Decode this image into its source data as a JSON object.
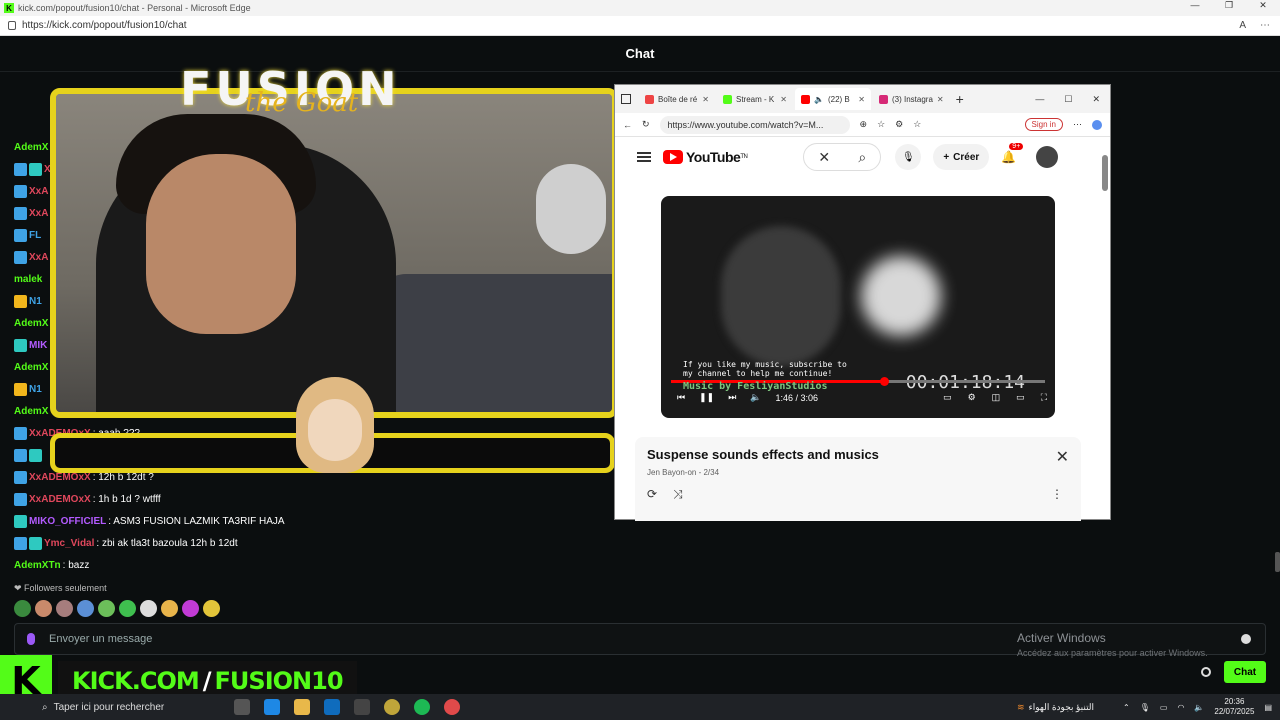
{
  "edge": {
    "title": "kick.com/popout/fusion10/chat - Personal - Microsoft Edge",
    "url": "https://kick.com/popout/fusion10/chat"
  },
  "chat": {
    "header": "Chat",
    "messages": [
      {
        "user": "AdemX",
        "text": ":",
        "color": "#53fc18",
        "badges": []
      },
      {
        "user": "XxA",
        "text": "",
        "color": "#e0475c",
        "badges": [
          "b-blue",
          "b-teal"
        ]
      },
      {
        "user": "XxA",
        "text": "",
        "color": "#e0475c",
        "badges": [
          "b-blue"
        ]
      },
      {
        "user": "XxA",
        "text": "",
        "color": "#e0475c",
        "badges": [
          "b-blue"
        ]
      },
      {
        "user": "FL",
        "text": "",
        "color": "#3fa3e6",
        "badges": [
          "b-blue"
        ]
      },
      {
        "user": "XxA",
        "text": "",
        "color": "#e0475c",
        "badges": [
          "b-blue"
        ]
      },
      {
        "user": "malek",
        "text": "",
        "color": "#53fc18",
        "badges": []
      },
      {
        "user": "N1",
        "text": "",
        "color": "#3fa3e6",
        "badges": [
          "b-gold"
        ]
      },
      {
        "user": "AdemX",
        "text": ":",
        "color": "#53fc18",
        "badges": []
      },
      {
        "user": "MIK",
        "text": "",
        "color": "#b35bff",
        "badges": [
          "b-teal"
        ]
      },
      {
        "user": "AdemX",
        "text": ":",
        "color": "#53fc18",
        "badges": []
      },
      {
        "user": "N1",
        "text": "",
        "color": "#3fa3e6",
        "badges": [
          "b-gold"
        ]
      },
      {
        "user": "AdemX",
        "text": "",
        "color": "#53fc18",
        "badges": []
      },
      {
        "user": "XxADEMOxX",
        "text": ": aaah ???",
        "color": "#e0475c",
        "badges": [
          "b-blue"
        ]
      },
      {
        "user": "",
        "text": "",
        "color": "#ffffff",
        "badges": [
          "b-blue",
          "b-teal"
        ]
      },
      {
        "user": "XxADEMOxX",
        "text": ": 12h b 12dt ?",
        "color": "#e0475c",
        "badges": [
          "b-blue"
        ]
      },
      {
        "user": "XxADEMOxX",
        "text": ": 1h b 1d ? wtfff",
        "color": "#e0475c",
        "badges": [
          "b-blue"
        ]
      },
      {
        "user": "MIKO_OFFICIEL",
        "text": ": ASM3 FUSION LAZMIK TA3RIF HAJA",
        "color": "#b35bff",
        "badges": [
          "b-teal"
        ]
      },
      {
        "user": "Ymc_Vidal",
        "text": ": zbi ak tla3t bazoula 12h b 12dt",
        "color": "#e0475c",
        "badges": [
          "b-blue",
          "b-teal"
        ]
      },
      {
        "user": "AdemXTn",
        "text": ": bazz",
        "color": "#53fc18",
        "badges": []
      }
    ],
    "followers_label": "❤ Followers seulement",
    "input_placeholder": "Envoyer un message",
    "send_label": "Chat"
  },
  "overlay": {
    "title": "FUSION",
    "subtitle": "the Goat",
    "kick_left": "KICK.COM",
    "kick_slash": "/",
    "kick_right": "FUSION10"
  },
  "windows_activation": {
    "title": "Activer Windows",
    "sub": "Accédez aux paramètres pour activer Windows."
  },
  "youtube_window": {
    "tabs": [
      {
        "label": "Boîte de ré",
        "color": "#e44"
      },
      {
        "label": "Stream - K",
        "color": "#53fc18"
      },
      {
        "label": "(22) B",
        "color": "#f00"
      },
      {
        "label": "(3) Instagra",
        "color": "#d62976"
      }
    ],
    "url": "https://www.youtube.com/watch?v=M...",
    "signin": "Sign in",
    "logo": "YouTube",
    "logo_tn": "TN",
    "create": "Créer",
    "notif_count": "9+",
    "video_caption1": "If you like my music, subscribe to",
    "video_caption2": "my channel to help me continue!",
    "video_credit": "Music by FesliyanStudios",
    "video_timer": "00:01:18:14",
    "video_time": "1:46 / 3:06",
    "progress": 0.57,
    "playlist_title": "Suspense sounds effects and musics",
    "playlist_sub": "Jen Bayon-on - 2/34"
  },
  "taskbar": {
    "search": "Taper ici pour rechercher",
    "weather": "التنبؤ بجودة الهواء",
    "time": "20:36",
    "date": "22/07/2025"
  }
}
